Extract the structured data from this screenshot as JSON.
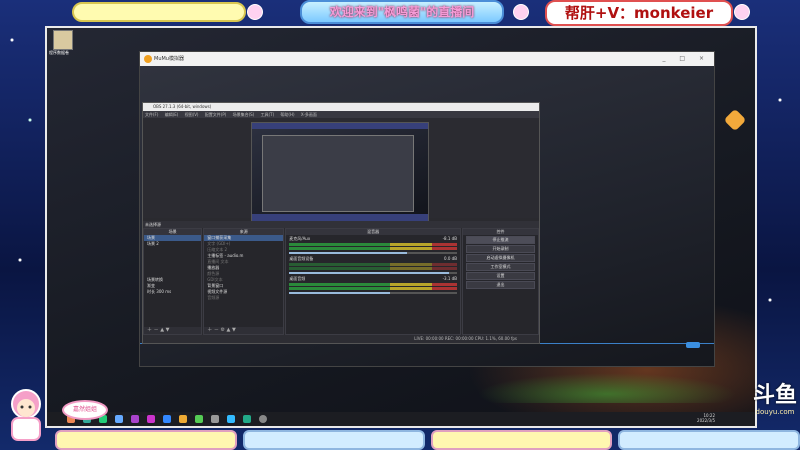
{
  "overlay": {
    "welcome_text": "欢迎来到\"枫鸣菌\"的直播间",
    "contact_text": "帮肝+V：monkeier",
    "mascot_bubble": "嘉然姐姐",
    "platform_logo": "斗鱼",
    "platform_url": "douyu.com"
  },
  "desktop": {
    "icon_label": "程序数据卷"
  },
  "mumu": {
    "title": "MuMu模拟器",
    "window_controls": [
      "_",
      "□",
      "×"
    ]
  },
  "obs": {
    "title": "OBS 27.1.3 (64-bit, windows)",
    "menu": [
      "文件(F)",
      "编辑(E)",
      "视图(V)",
      "配置文件(P)",
      "场景集合(S)",
      "工具(T)",
      "帮助(H)",
      "X-多画面"
    ],
    "preview_caption": "大屏下给开播动态",
    "panel_bar": "未选择源",
    "scenes": {
      "header": "场景",
      "items": [
        "场景",
        "场景 2"
      ],
      "transition_label": "场景转换",
      "transition_value": "渐变",
      "duration_label": "时长",
      "duration_value": "300 ms"
    },
    "sources": {
      "header": "来源",
      "items": [
        {
          "label": "窗口捕获采集",
          "dim": false
        },
        {
          "label": "文字 (GDI+)",
          "dim": true
        },
        {
          "label": "压缩文本 2",
          "dim": true
        },
        {
          "label": "主播标签 - audio.m",
          "dim": false
        },
        {
          "label": "直播间 文本",
          "dim": true
        },
        {
          "label": "播放器",
          "dim": false
        },
        {
          "label": "颜色源",
          "dim": true
        },
        {
          "label": "GDI文本",
          "dim": true
        },
        {
          "label": "背景窗口",
          "dim": false
        },
        {
          "label": "视频文件源",
          "dim": false
        },
        {
          "label": "音频源",
          "dim": true
        }
      ]
    },
    "mixer": {
      "header": "混音器",
      "channels": [
        {
          "name": "麦克风/Aux",
          "db": "-8.1 dB",
          "level": 0.7,
          "active": true
        },
        {
          "name": "桌面音频设备",
          "db": "0.0 dB",
          "level": 0.95,
          "active": false
        },
        {
          "name": "桌面音频",
          "db": "-3.1 dB",
          "level": 0.6,
          "active": true
        }
      ]
    },
    "controls": {
      "header": "控件",
      "buttons": [
        "停止推流",
        "开始录制",
        "启动虚拟摄像机",
        "工作室模式",
        "设置",
        "退出"
      ],
      "active_index": 0
    },
    "status": "LIVE: 00:00:00   REC: 00:00:00   CPU: 1.1%, 60.00 fps"
  },
  "taskbar": {
    "time": "10:22",
    "date": "2022/3/5"
  },
  "colors": {
    "accent": "#3b8fe0",
    "frame_blue": "#0b1a4a",
    "pink": "#f19bc4"
  }
}
